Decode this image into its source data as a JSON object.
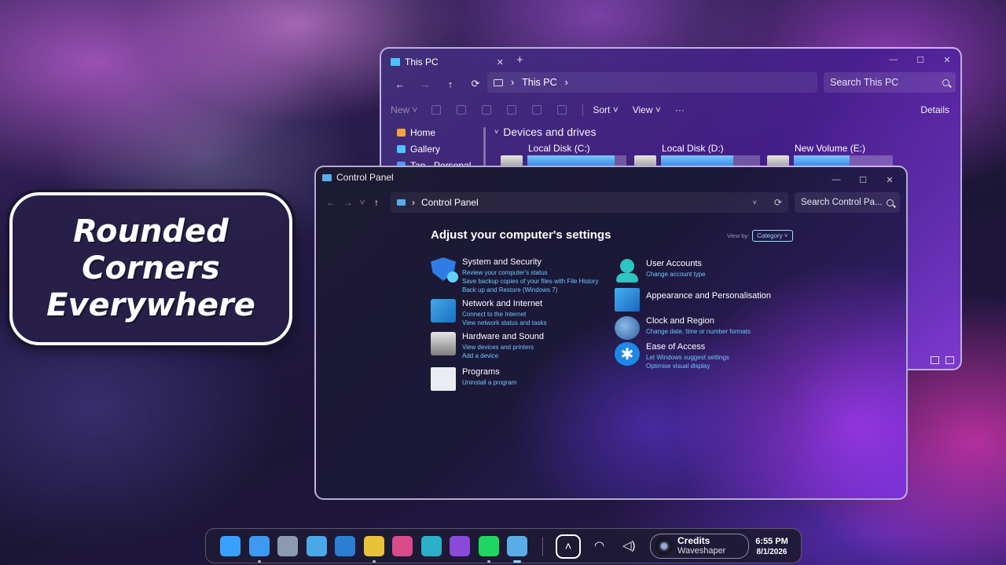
{
  "title_card": {
    "line1": "Rounded",
    "line2": "Corners",
    "line3": "Everywhere"
  },
  "this_pc": {
    "tab_title": "This PC",
    "tab_close": "✕",
    "new_tab": "+",
    "controls": {
      "minimize": "—",
      "maximize": "☐",
      "close": "✕"
    },
    "nav": {
      "back": "←",
      "forward": "→",
      "up": "↑",
      "refresh": "⟳"
    },
    "address": {
      "path": "This PC",
      "separator": "›"
    },
    "search_placeholder": "Search This PC",
    "toolbar": {
      "new": "New ˅",
      "sort": "Sort ˅",
      "view": "View ˅",
      "more": "···",
      "details": "Details"
    },
    "sidebar": [
      {
        "label": "Home",
        "icon": "home-icon",
        "color": "#f2a53a"
      },
      {
        "label": "Gallery",
        "icon": "gallery-icon",
        "color": "#4cc2ff"
      },
      {
        "label": "Tan - Personal",
        "icon": "cloud-icon",
        "color": "#4c9bff"
      }
    ],
    "section_title": "Devices and drives",
    "drives": [
      {
        "label": "Local Disk (C:)",
        "used_fraction": 0.88
      },
      {
        "label": "Local Disk (D:)",
        "used_fraction": 0.73
      },
      {
        "label": "New Volume (E:)",
        "used_fraction": 0.56
      }
    ]
  },
  "control_panel": {
    "title": "Control Panel",
    "controls": {
      "minimize": "—",
      "maximize": "☐",
      "close": "✕"
    },
    "nav": {
      "back": "←",
      "forward": "→",
      "dropdown": "˅",
      "up": "↑"
    },
    "address": {
      "path": "Control Panel",
      "separator": "›",
      "chevron": "˅",
      "refresh": "⟳"
    },
    "search_placeholder": "Search Control Pa...",
    "heading": "Adjust your computer's settings",
    "view_by": {
      "label": "View by:",
      "value": "Category ˅"
    },
    "categories_left": [
      {
        "title": "System and Security",
        "icon": "shield-icon",
        "links": [
          "Review your computer's status",
          "Save backup copies of your files with File History",
          "Back up and Restore (Windows 7)"
        ]
      },
      {
        "title": "Network and Internet",
        "icon": "network-icon",
        "links": [
          "Connect to the Internet",
          "View network status and tasks"
        ]
      },
      {
        "title": "Hardware and Sound",
        "icon": "printer-icon",
        "links": [
          "View devices and printers",
          "Add a device"
        ]
      },
      {
        "title": "Programs",
        "icon": "programs-icon",
        "links": [
          "Uninstall a program"
        ]
      }
    ],
    "categories_right": [
      {
        "title": "User Accounts",
        "icon": "user-accounts-icon",
        "links": [
          "Change account type"
        ]
      },
      {
        "title": "Appearance and Personalisation",
        "icon": "appearance-icon",
        "links": []
      },
      {
        "title": "Clock and Region",
        "icon": "clock-icon",
        "links": [
          "Change date, time or number formats"
        ]
      },
      {
        "title": "Ease of Access",
        "icon": "accessibility-icon",
        "links": [
          "Let Windows suggest settings",
          "Optimise visual display"
        ]
      }
    ]
  },
  "taskbar": {
    "apps": [
      {
        "name": "start-icon",
        "color": "#3aa0ff"
      },
      {
        "name": "file-explorer-icon",
        "color": "#3d9af0"
      },
      {
        "name": "settings-icon",
        "color": "#8a9bb0"
      },
      {
        "name": "photos-icon",
        "color": "#4aa8e8"
      },
      {
        "name": "store-icon",
        "color": "#2a7fd4"
      },
      {
        "name": "chrome-icon",
        "color": "#e8c23a"
      },
      {
        "name": "widgets-icon",
        "color": "#d84a8a"
      },
      {
        "name": "edge-icon",
        "color": "#2ab0c8"
      },
      {
        "name": "clipchamp-icon",
        "color": "#8a4ad8"
      },
      {
        "name": "spotify-icon",
        "color": "#1ed760"
      },
      {
        "name": "control-panel-icon",
        "color": "#5aaee8"
      }
    ],
    "chevron": "˄",
    "wifi": "wifi-icon",
    "volume": "volume-icon",
    "media": {
      "title": "Credits",
      "artist": "Waveshaper"
    },
    "clock": {
      "time": "6:55 PM",
      "date": "8/1/2026"
    }
  }
}
